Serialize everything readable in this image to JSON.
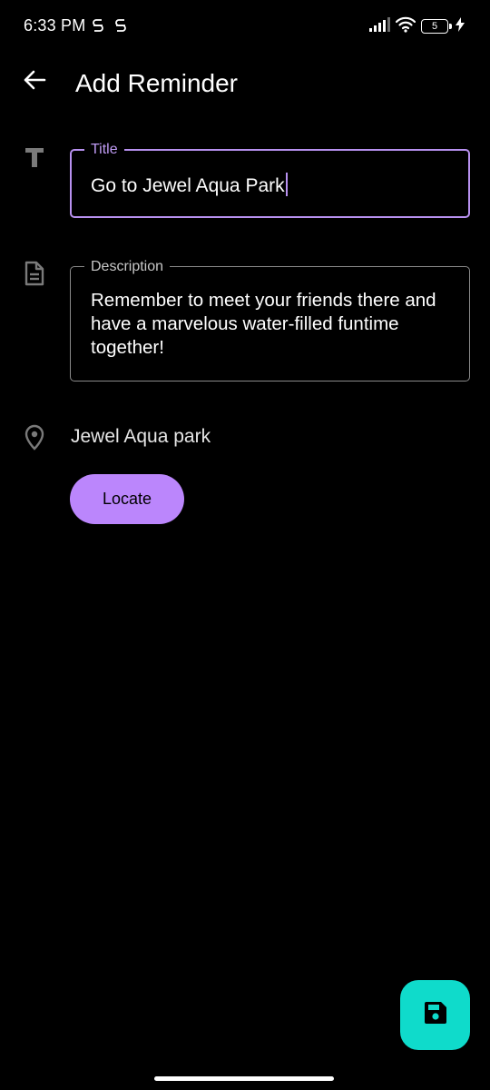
{
  "status_bar": {
    "time": "6:33 PM",
    "battery_level": "5",
    "signal_bars": 4,
    "icons": [
      "notification-s-icon",
      "notification-s-icon",
      "signal-icon",
      "wifi-icon",
      "battery-icon",
      "charging-bolt-icon"
    ]
  },
  "app_bar": {
    "back_icon": "arrow-left-icon",
    "title": "Add Reminder"
  },
  "form": {
    "title_field": {
      "icon": "title-t-icon",
      "label": "Title",
      "value": "Go to Jewel Aqua Park",
      "focused": true
    },
    "description_field": {
      "icon": "document-icon",
      "label": "Description",
      "value": "Remember to meet your friends there and have a marvelous water-filled funtime together!"
    },
    "location": {
      "icon": "location-pin-icon",
      "value": "Jewel Aqua park"
    },
    "locate_button": {
      "label": "Locate"
    }
  },
  "fab": {
    "icon": "save-icon"
  },
  "colors": {
    "background": "#000000",
    "accent": "#bb86fc",
    "fab": "#0fdbcb",
    "outline_inactive": "#8a8a8a"
  }
}
